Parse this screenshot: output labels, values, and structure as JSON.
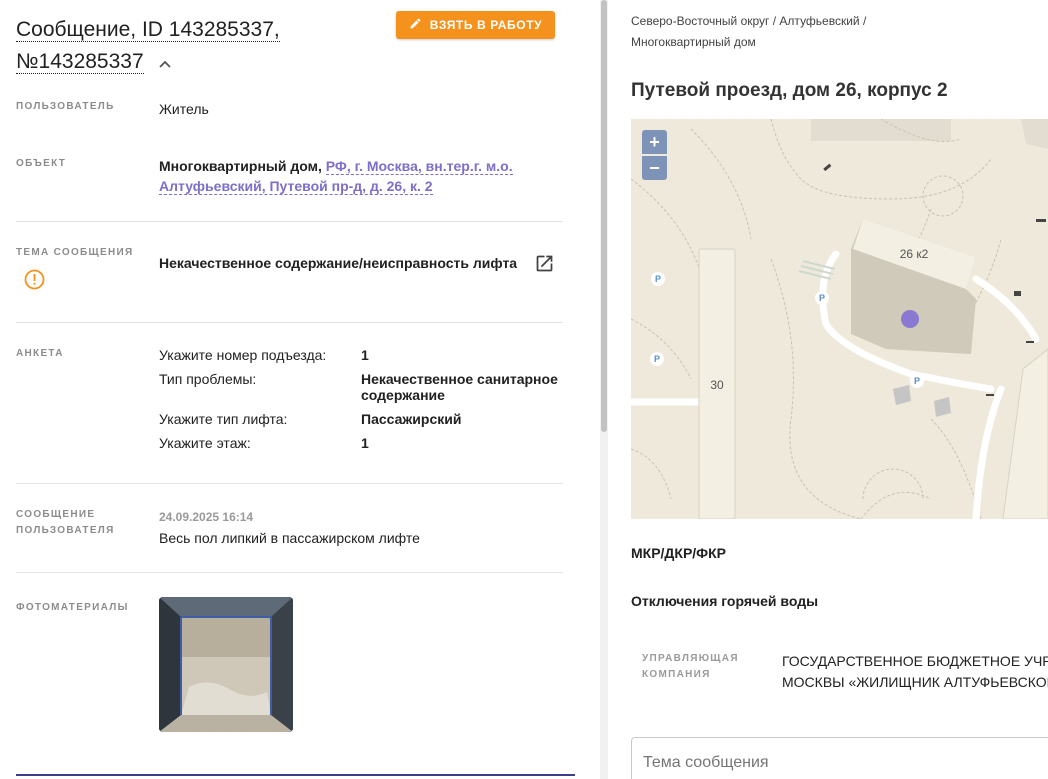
{
  "header": {
    "title_line1": "Сообщение, ID 143285337,",
    "title_line2": "№143285337",
    "work_button": "ВЗЯТЬ В РАБОТУ"
  },
  "fields": {
    "user_label": "ПОЛЬЗОВАТЕЛЬ",
    "user_value": "Житель",
    "object_label": "ОБЪЕКТ",
    "object_type": "Многоквартирный дом,",
    "object_address_line1": "РФ, г. Москва, вн.тер.г. м.о.",
    "object_address_line2": "Алтуфьевский, Путевой пр-д, д. 26, к. 2",
    "topic_label": "ТЕМА СООБЩЕНИЯ",
    "topic_value": "Некачественное содержание/неисправность лифта",
    "survey_label": "АНКЕТА",
    "survey": [
      {
        "q": "Укажите номер подъезда:",
        "a": "1"
      },
      {
        "q": "Тип проблемы:",
        "a": "Некачественное санитарное содержание"
      },
      {
        "q": "Укажите тип лифта:",
        "a": "Пассажирский"
      },
      {
        "q": "Укажите этаж:",
        "a": "1"
      }
    ],
    "message_label_line1": "СООБЩЕНИЕ",
    "message_label_line2": "ПОЛЬЗОВАТЕЛЯ",
    "message_date": "24.09.2025 16:14",
    "message_text": "Весь пол липкий в пассажирском лифте",
    "photos_label": "ФОТОМАТЕРИАЛЫ"
  },
  "right": {
    "breadcrumb_line1": "Северо-Восточный округ / Алтуфьевский /",
    "breadcrumb_line2": "Многоквартирный дом",
    "address": "Путевой проезд, дом 26, корпус 2",
    "map": {
      "zoom_in": "+",
      "zoom_out": "−",
      "building_label": "26 к2",
      "building_30": "30"
    },
    "section1": "МКР/ДКР/ФКР",
    "section2": "Отключения горячей воды",
    "mc_label_line1": "УПРАВЛЯЮЩАЯ",
    "mc_label_line2": "КОМПАНИЯ",
    "mc_value_line1": "ГОСУДАРСТВЕННОЕ БЮДЖЕТНОЕ УЧРЕЖ",
    "mc_value_line2": "МОСКВЫ «ЖИЛИЩНИК АЛТУФЬЕВСКОГО",
    "topic_placeholder": "Тема сообщения"
  },
  "colors": {
    "accent_orange": "#f5921e",
    "link_purple": "#7b6fc9",
    "marker_purple": "#8b78d3",
    "map_bg": "#eee9da"
  }
}
